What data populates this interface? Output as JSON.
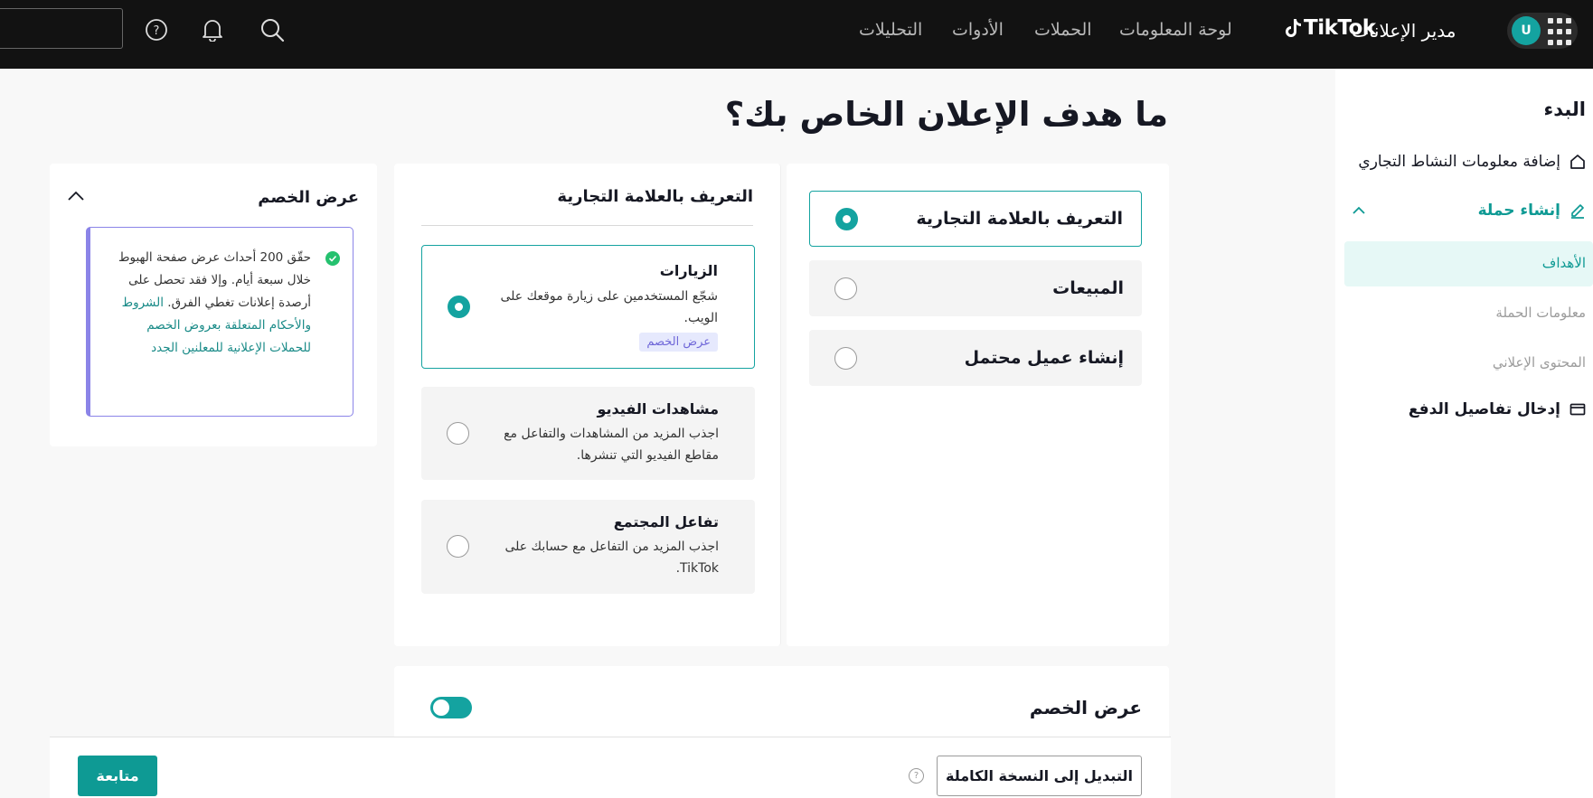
{
  "topbar": {
    "avatar_letter": "U",
    "brand_logo": "TikTok",
    "brand_name": "مدير الإعلانات",
    "nav": [
      "لوحة المعلومات",
      "الحملات",
      "الأدوات",
      "التحليلات"
    ],
    "icons": [
      "apps-grid-icon",
      "search-icon",
      "bell-icon",
      "help-icon"
    ]
  },
  "sidebar": {
    "title": "البدء",
    "items": [
      {
        "label": "إضافة معلومات النشاط التجاري",
        "icon": "home-icon"
      },
      {
        "label": "إنشاء حملة",
        "icon": "pencil-icon"
      },
      {
        "label": "إدخال تفاصيل الدفع",
        "icon": "card-icon"
      }
    ],
    "subitems": [
      "الأهداف",
      "معلومات الحملة",
      "المحتوى الإعلاني"
    ]
  },
  "main": {
    "title": "ما هدف الإعلان الخاص بك؟",
    "goals": [
      "التعريف بالعلامة التجارية",
      "المبيعات",
      "إنشاء عميل محتمل"
    ],
    "objective_section": {
      "heading": "التعريف بالعلامة التجارية",
      "options": [
        {
          "title": "الزيارات",
          "desc": "شجّع المستخدمين على زيارة موقعك على الويب.",
          "badge": "عرض الخصم"
        },
        {
          "title": "مشاهدات الفيديو",
          "desc": "اجذب المزيد من المشاهدات والتفاعل مع مقاطع الفيديو التي تنشرها."
        },
        {
          "title": "تفاعل المجتمع",
          "desc": "اجذب المزيد من التفاعل مع حسابك على TikTok."
        }
      ]
    },
    "promo": {
      "heading": "عرض الخصم",
      "text": "حقّق 200 أحداث عرض صفحة الهبوط خلال سبعة أيام. وإلا فقد تحصل على أرصدة إعلانات تغطي الفرق.",
      "link": "الشروط والأحكام المتعلقة بعروض الخصم للحملات الإعلانية للمعلنين الجدد"
    },
    "discount": {
      "heading": "عرض الخصم"
    }
  },
  "footer": {
    "switch_label": "التبديل إلى النسخة الكاملة",
    "continue_label": "متابعة"
  },
  "colors": {
    "accent": "#14a3a0",
    "topbar": "#121212",
    "promo_border": "#8b84e8"
  }
}
